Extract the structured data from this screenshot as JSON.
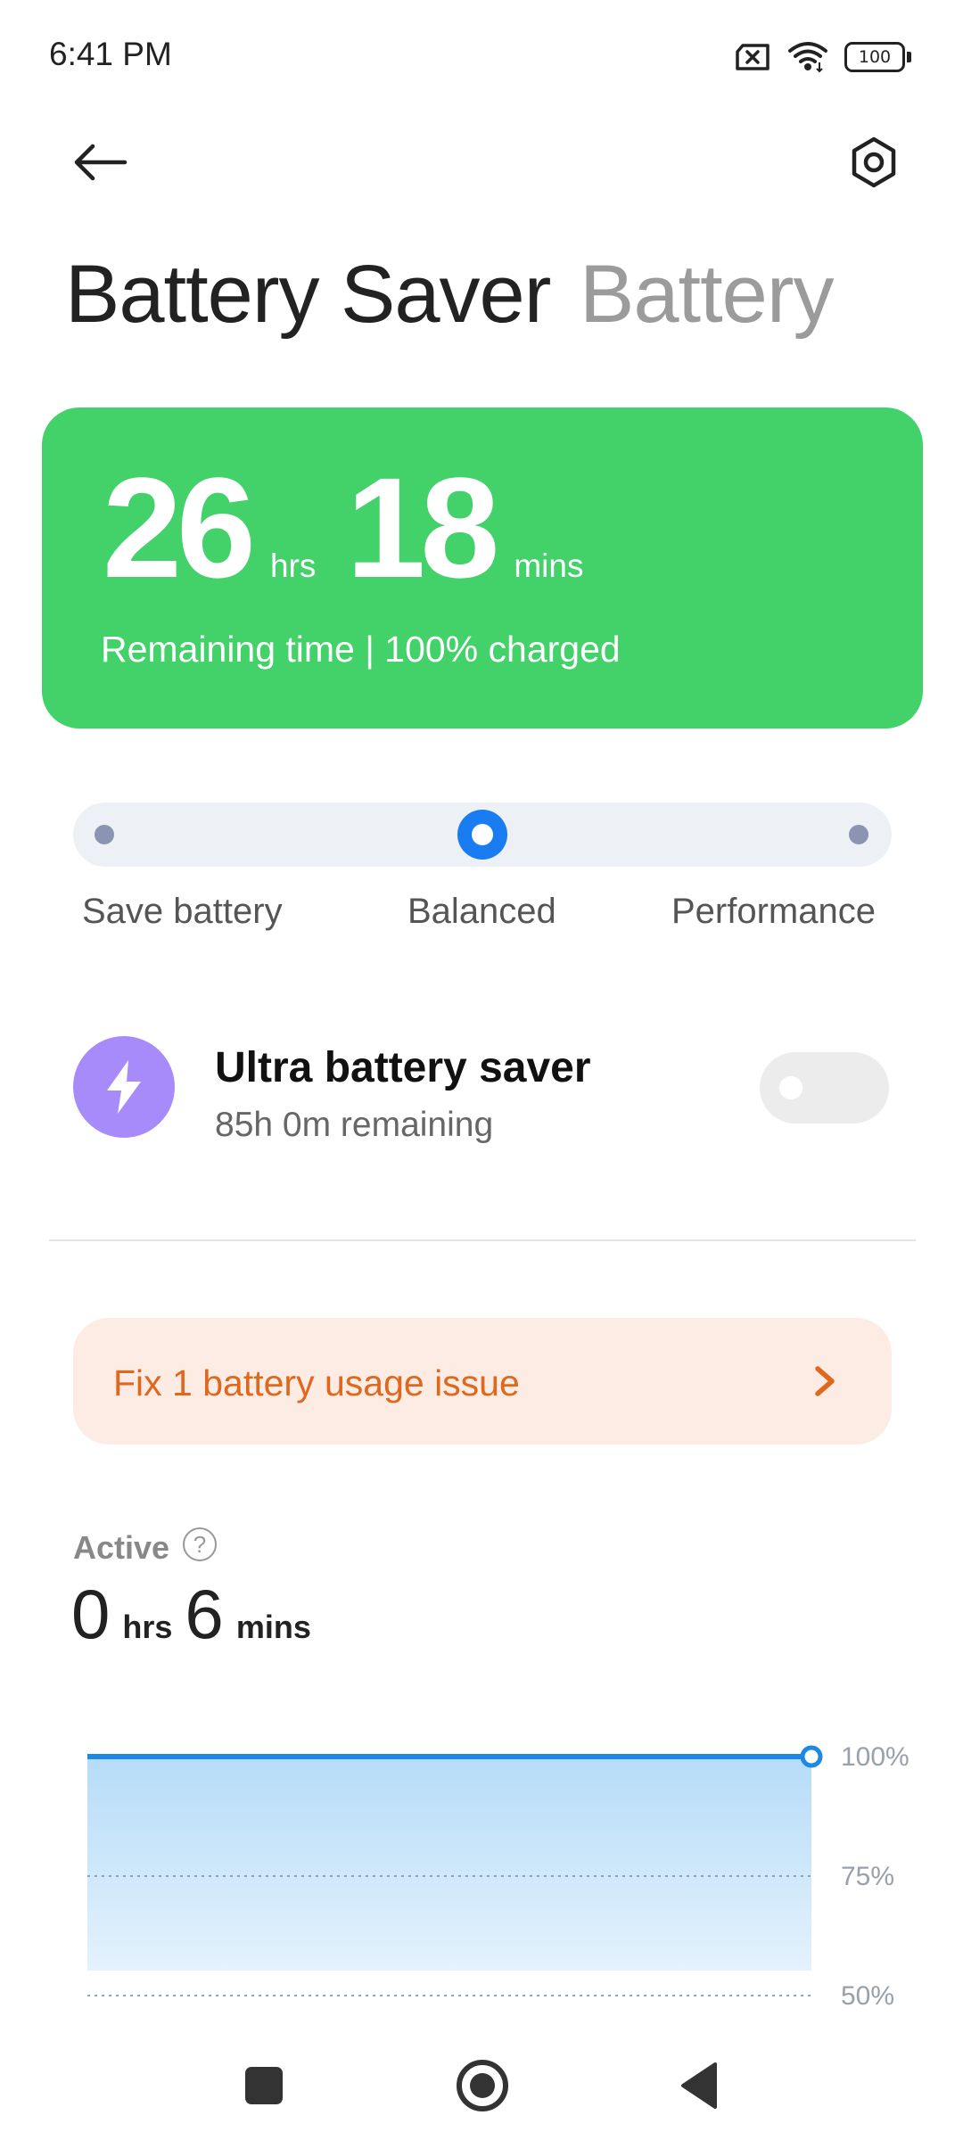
{
  "status_bar": {
    "time": "6:41 PM",
    "battery_level": "100"
  },
  "header": {
    "icons": {
      "back": "back-arrow-icon",
      "settings": "hexagon-settings-icon"
    },
    "tabs": [
      {
        "label": "Battery Saver",
        "active": true
      },
      {
        "label": "Battery",
        "active": false
      }
    ]
  },
  "remaining": {
    "hours": "26",
    "hours_unit": "hrs",
    "minutes": "18",
    "minutes_unit": "mins",
    "caption": "Remaining time | 100% charged",
    "card_color": "#43d16a"
  },
  "modes": {
    "options": [
      "Save battery",
      "Balanced",
      "Performance"
    ],
    "selected": "Balanced",
    "accent_color": "#1a7cf1"
  },
  "ultra_saver": {
    "title": "Ultra battery saver",
    "subtitle": "85h 0m remaining",
    "enabled": false,
    "icon": "lightning-bolt-icon",
    "icon_bg": "#a78bfa"
  },
  "issue_banner": {
    "text": "Fix 1 battery usage issue",
    "text_color": "#e0681e",
    "bg_color": "#fdece3"
  },
  "active": {
    "label": "Active",
    "hours": "0",
    "hours_unit": "hrs",
    "minutes": "6",
    "minutes_unit": "mins"
  },
  "chart_data": {
    "type": "area",
    "y_ticks": [
      "100%",
      "75%",
      "50%"
    ],
    "ylim": [
      50,
      100
    ],
    "series": [
      {
        "values": [
          100,
          100
        ]
      }
    ],
    "line_color": "#1e88e5"
  }
}
